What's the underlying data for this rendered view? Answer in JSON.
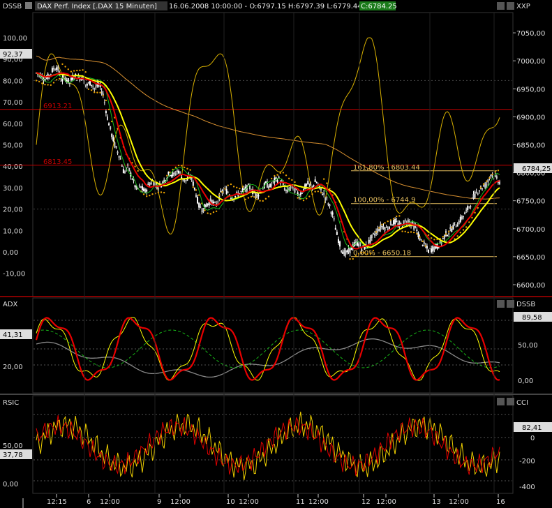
{
  "title_bar": {
    "icon": "chart-icon",
    "title": "DAX Perf. Index [.DAX  15 Minuten]",
    "quote": "16.06.2008 10:00:00 - O:6797.15 H:6797.39 L:6779.44",
    "close": "C:6784.25"
  },
  "colors": {
    "background": "#000000",
    "candle_up": "#ffffff",
    "candle_down": "#ffffff",
    "dssb": "#e8c000",
    "ma_yellow": "#ffff00",
    "ma_red": "#e80000",
    "ma_green": "#18b818",
    "ma_orange": "#e0a040",
    "dots": "#e8a000",
    "horizontal_line": "#c80000",
    "adx_gray": "#888888",
    "rsic_yellow": "#f0d000",
    "rsic_red": "#e00000"
  },
  "chart_data": [
    {
      "type": "candlestick",
      "panel": "price",
      "left_axis": {
        "name": "DSSB",
        "ticks": [
          "100,00",
          "90,00",
          "80,00",
          "70,00",
          "60,00",
          "50,00",
          "40,00",
          "30,00",
          "20,00",
          "10,00",
          "0,00",
          "-10,00"
        ],
        "current": "92,37"
      },
      "right_axis": {
        "name": "XXP",
        "ticks": [
          "7050,00",
          "7000,00",
          "6950,00",
          "6900,00",
          "6850,00",
          "6800,00",
          "6750,00",
          "6700,00",
          "6650,00",
          "6600,00"
        ],
        "current": "6784,25",
        "ylim": [
          6580,
          7075
        ]
      },
      "x_ticks": [
        "12:15",
        "6",
        "12:00",
        "9",
        "12:00",
        "10",
        "12:00",
        "11",
        "12:00",
        "12",
        "12:00",
        "13",
        "12:00",
        "16"
      ],
      "horizontal_lines": [
        {
          "label": "6913.21",
          "value": 6913.21
        },
        {
          "label": "6813.45",
          "value": 6813.45
        }
      ],
      "fibonacci": [
        {
          "label": "161,80% - 6803.44",
          "value": 6803.44
        },
        {
          "label": "100,00% - 6744.9",
          "value": 6744.9
        },
        {
          "label": "0,00% - 6650.18",
          "value": 6650.18
        }
      ],
      "price_path": [
        6978,
        6975,
        6968,
        6972,
        6985,
        6990,
        6965,
        6970,
        6960,
        6975,
        6968,
        6972,
        6955,
        6962,
        6950,
        6958,
        6940,
        6900,
        6870,
        6845,
        6830,
        6800,
        6810,
        6790,
        6770,
        6775,
        6765,
        6780,
        6785,
        6775,
        6780,
        6790,
        6800,
        6795,
        6805,
        6790,
        6785,
        6795,
        6770,
        6740,
        6735,
        6745,
        6750,
        6740,
        6760,
        6770,
        6765,
        6755,
        6760,
        6765,
        6770,
        6775,
        6765,
        6760,
        6770,
        6780,
        6775,
        6785,
        6790,
        6780,
        6765,
        6775,
        6770,
        6760,
        6770,
        6780,
        6775,
        6785,
        6770,
        6760,
        6745,
        6725,
        6690,
        6665,
        6655,
        6660,
        6670,
        6675,
        6665,
        6668,
        6680,
        6690,
        6700,
        6705,
        6700,
        6710,
        6712,
        6705,
        6710,
        6715,
        6708,
        6700,
        6680,
        6670,
        6660,
        6665,
        6668,
        6675,
        6690,
        6695,
        6705,
        6710,
        6720,
        6730,
        6745,
        6760,
        6770,
        6775,
        6780,
        6800,
        6790,
        6784
      ]
    },
    {
      "type": "line",
      "panel": "adx",
      "left_axis": {
        "name": "ADX",
        "ticks": [
          "20,00"
        ],
        "current": "41,31"
      },
      "right_axis": {
        "name": "DSSB",
        "ticks": [
          "50,00",
          "0,00"
        ],
        "current": "89,58"
      }
    },
    {
      "type": "line",
      "panel": "rsic",
      "left_axis": {
        "name": "RSIC",
        "ticks": [
          "50,00",
          "0,00"
        ],
        "current": "37,78"
      },
      "right_axis": {
        "name": "CCI",
        "ticks": [
          "0",
          "-200",
          "-400"
        ],
        "current": "82,41"
      }
    }
  ]
}
